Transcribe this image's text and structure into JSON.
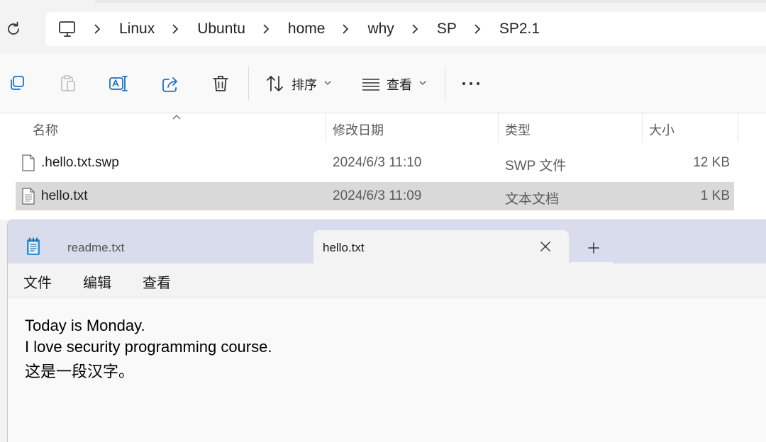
{
  "explorer": {
    "breadcrumb": [
      "Linux",
      "Ubuntu",
      "home",
      "why",
      "SP",
      "SP2.1"
    ],
    "toolbar": {
      "sort_label": "排序",
      "view_label": "查看"
    },
    "columns": [
      "名称",
      "修改日期",
      "类型",
      "大小"
    ],
    "files": [
      {
        "name": ".hello.txt.swp",
        "modified": "2024/6/3 11:10",
        "type": "SWP 文件",
        "size": "12 KB",
        "selected": false
      },
      {
        "name": "hello.txt",
        "modified": "2024/6/3 11:09",
        "type": "文本文档",
        "size": "1 KB",
        "selected": true
      }
    ]
  },
  "notepad": {
    "tabs": [
      {
        "title": "readme.txt",
        "active": false
      },
      {
        "title": "hello.txt",
        "active": true
      }
    ],
    "menu": [
      "文件",
      "编辑",
      "查看"
    ],
    "content": [
      "Today is Monday.",
      "I love security programming course.",
      "这是一段汉字。"
    ]
  },
  "icons": {
    "refresh": "refresh-icon",
    "computer": "computer-icon",
    "copy": "copy-icon",
    "paste": "paste-icon",
    "rename": "rename-icon",
    "share": "share-icon",
    "delete": "trash-icon",
    "sort": "sort-icon",
    "view": "view-icon",
    "more": "more-icon",
    "notepad": "notepad-icon"
  },
  "colors": {
    "selection": "#d9d9d9",
    "notepad_tabbar": "#d9dced",
    "notepad_icon": "#2b8fd6"
  }
}
